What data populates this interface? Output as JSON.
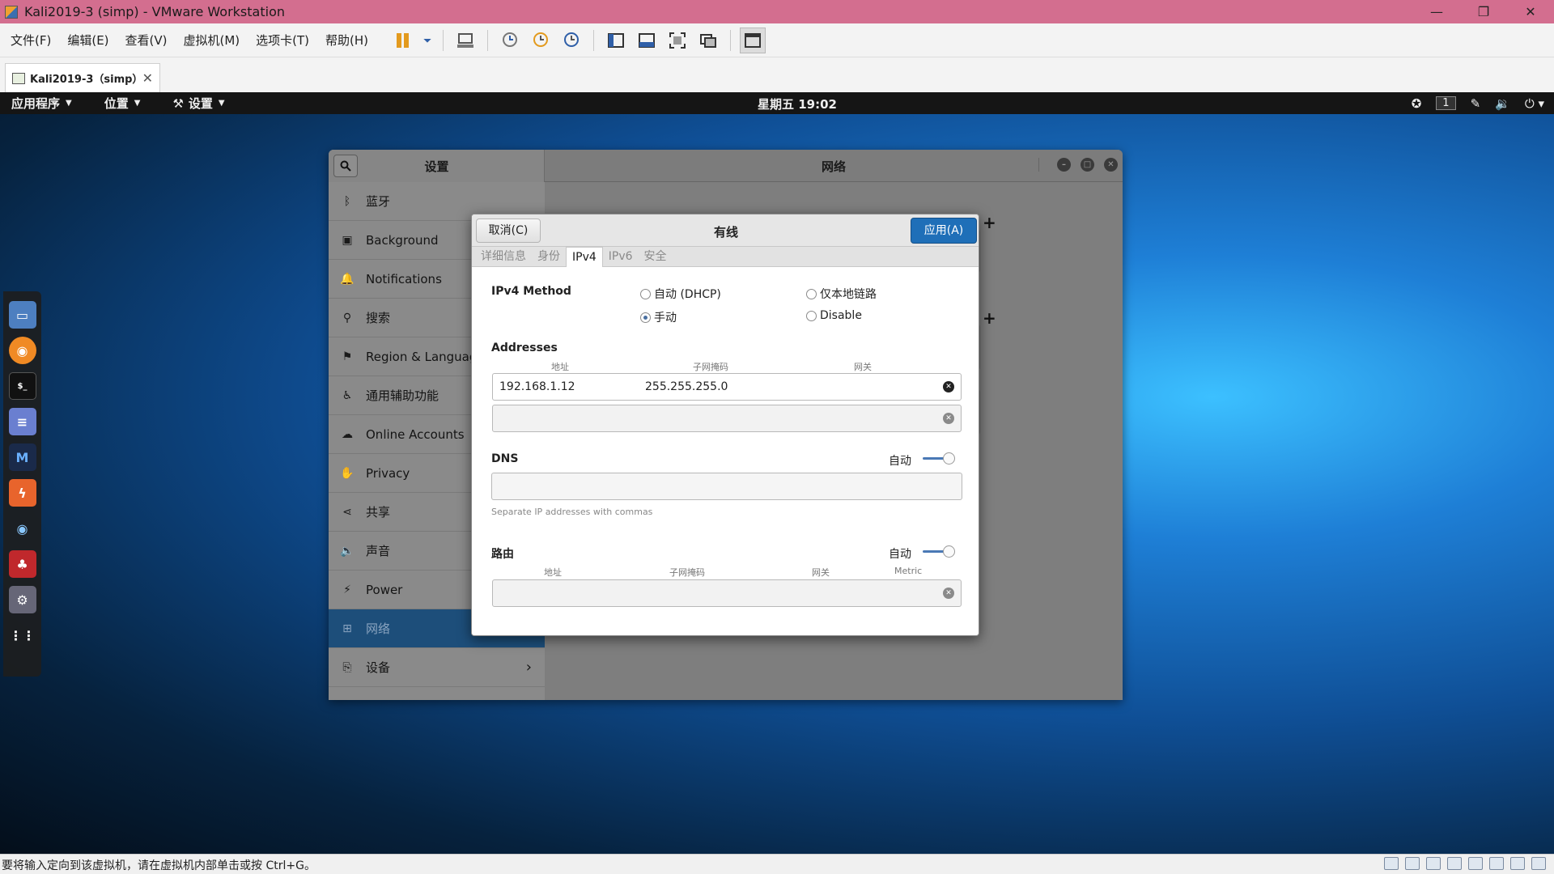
{
  "window": {
    "title": "Kali2019-3  (simp)  - VMware Workstation",
    "controls": [
      "—",
      "❐",
      "✕"
    ]
  },
  "vmware": {
    "menu": [
      "文件(F)",
      "编辑(E)",
      "查看(V)",
      "虚拟机(M)",
      "选项卡(T)",
      "帮助(H)"
    ],
    "tab_label": "Kali2019-3（simp）",
    "tab_close": "✕",
    "status_message": "要将输入定向到该虚拟机，请在虚拟机内部单击或按 Ctrl+G。"
  },
  "gnome": {
    "apps_menu": "应用程序",
    "places_menu": "位置",
    "settings_menu": "设置",
    "clock": "星期五 19:02",
    "workspace": "1"
  },
  "settings": {
    "left_title": "设置",
    "right_title": "网络",
    "sidebar": [
      {
        "label": "蓝牙",
        "icon": "bluetooth-icon"
      },
      {
        "label": "Background",
        "icon": "background-icon"
      },
      {
        "label": "Notifications",
        "icon": "bell-icon"
      },
      {
        "label": "搜索",
        "icon": "search-icon"
      },
      {
        "label": "Region & Language",
        "icon": "flag-icon"
      },
      {
        "label": "通用辅助功能",
        "icon": "accessibility-icon"
      },
      {
        "label": "Online Accounts",
        "icon": "cloud-icon"
      },
      {
        "label": "Privacy",
        "icon": "hand-icon"
      },
      {
        "label": "共享",
        "icon": "share-icon"
      },
      {
        "label": "声音",
        "icon": "speaker-icon"
      },
      {
        "label": "Power",
        "icon": "power-icon"
      },
      {
        "label": "网络",
        "icon": "network-icon"
      },
      {
        "label": "设备",
        "icon": "devices-icon"
      }
    ],
    "selected": "网络",
    "plus": "+"
  },
  "dialog": {
    "cancel": "取消(C)",
    "title": "有线",
    "apply": "应用(A)",
    "tabs": [
      "详细信息",
      "身份",
      "IPv4",
      "IPv6",
      "安全"
    ],
    "active_tab": "IPv4",
    "ipv4_method_label": "IPv4 Method",
    "methods": {
      "auto": "自动 (DHCP)",
      "link_local": "仅本地链路",
      "manual": "手动",
      "disable": "Disable"
    },
    "selected_method": "手动",
    "addresses_label": "Addresses",
    "col_address": "地址",
    "col_netmask": "子网掩码",
    "col_gateway": "网关",
    "address_row": {
      "address": "192.168.1.12",
      "netmask": "255.255.255.0",
      "gateway": ""
    },
    "dns_label": "DNS",
    "dns_auto_label": "自动",
    "dns_auto": true,
    "dns_value": "",
    "dns_hint": "Separate IP addresses with commas",
    "routes_label": "路由",
    "routes_auto_label": "自动",
    "routes_auto": true,
    "col_metric": "Metric",
    "remove_icon": "✕"
  },
  "colors": {
    "title_bar": "#d36e8f",
    "apply_button": "#1f6fb8",
    "sidebar_selected": "#1d4e7a"
  }
}
